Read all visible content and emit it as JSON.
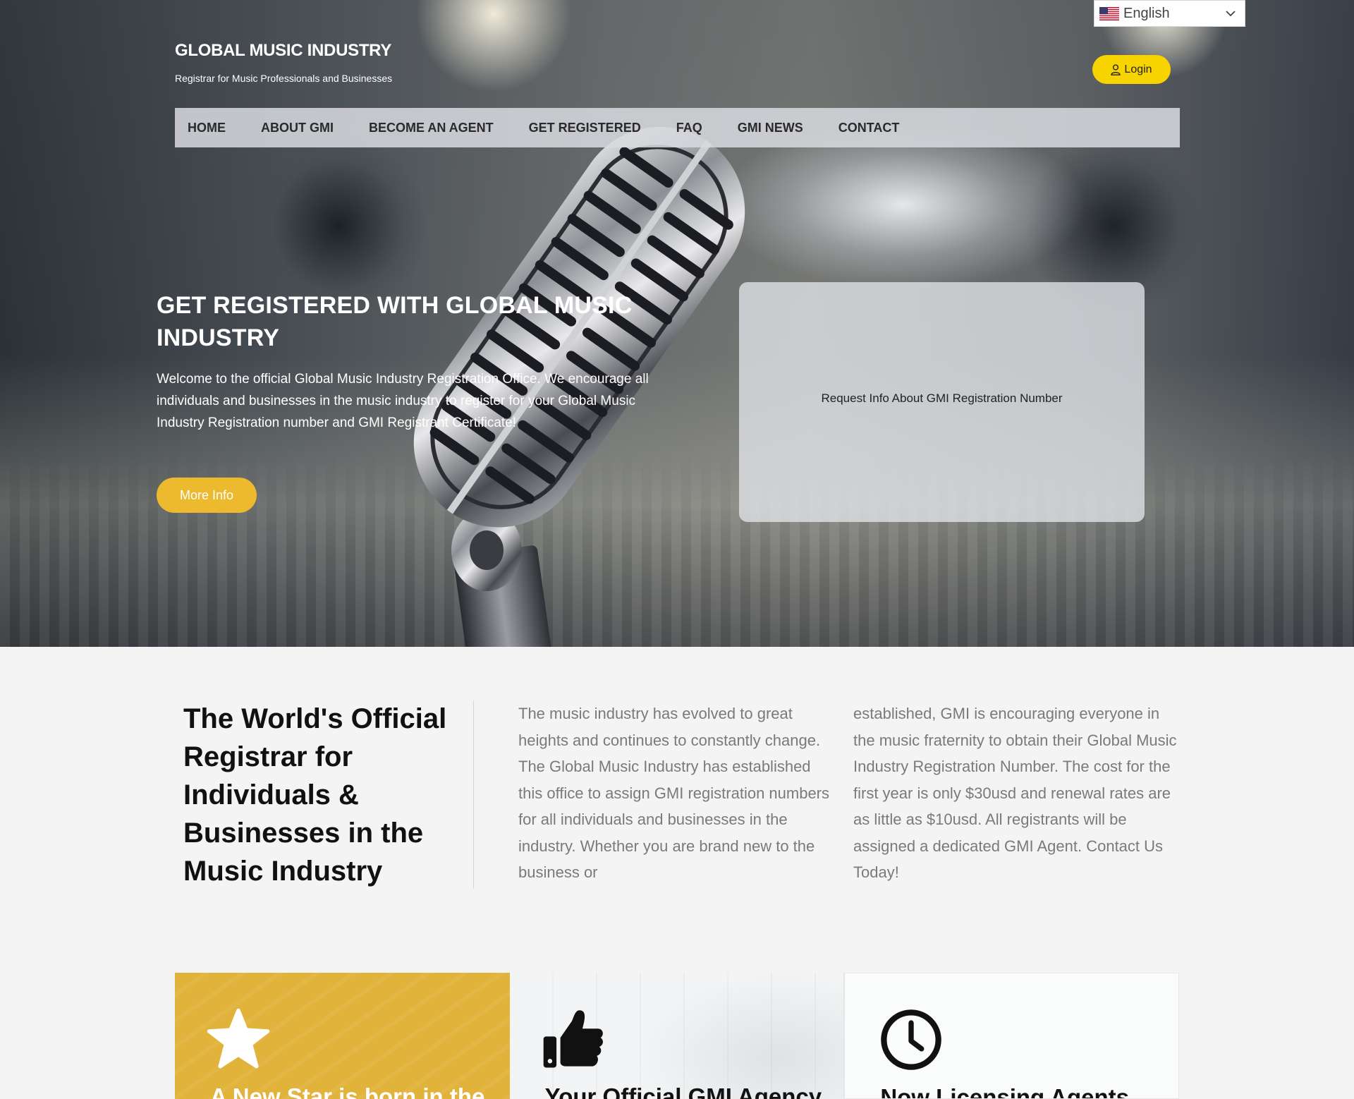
{
  "header": {
    "site_title": "GLOBAL MUSIC INDUSTRY",
    "tagline": "Registrar for Music Professionals and Businesses"
  },
  "language_selector": {
    "selected": "English",
    "flag_icon": "us-flag-icon"
  },
  "login": {
    "label": "Login",
    "icon": "user-icon"
  },
  "nav": {
    "items": [
      {
        "label": "HOME"
      },
      {
        "label": "ABOUT GMI"
      },
      {
        "label": "BECOME AN AGENT"
      },
      {
        "label": "GET REGISTERED"
      },
      {
        "label": "FAQ"
      },
      {
        "label": "GMI NEWS"
      },
      {
        "label": "CONTACT"
      }
    ]
  },
  "hero": {
    "heading": "GET REGISTERED WITH GLOBAL MUSIC INDUSTRY",
    "body": "Welcome to the official Global Music Industry Registration Office. We encourage all individuals and businesses in the music industry to register for your Global Music Industry Registration number and GMI Registrant Certificate!",
    "button_label": "More Info",
    "form_box_title": "Request Info About GMI Registration Number"
  },
  "about": {
    "heading": "The World's Official Registrar for Individuals & Businesses in the Music Industry",
    "column_1": "The music industry has evolved to great heights and continues to constantly change. The Global Music Industry has established this office to assign GMI registration numbers for all individuals and businesses in the industry.  Whether you are brand new to the business or",
    "column_2": "established, GMI is encouraging everyone in the music fraternity to obtain their Global Music Industry Registration Number.  The cost for the first year is only $30usd and renewal rates are as little as $10usd. All registrants will be assigned a dedicated GMI Agent. Contact Us Today!"
  },
  "cards": [
    {
      "title": "A New Star is born in the",
      "icon": "star-icon"
    },
    {
      "title": "Your Official GMI Agency",
      "icon": "thumbs-up-icon"
    },
    {
      "title": "Now Licensing Agents",
      "icon": "clock-icon"
    }
  ],
  "colors": {
    "accent_yellow": "#f7d300",
    "button_gold": "#ecb92f",
    "card_gold": "#e1b33a"
  }
}
